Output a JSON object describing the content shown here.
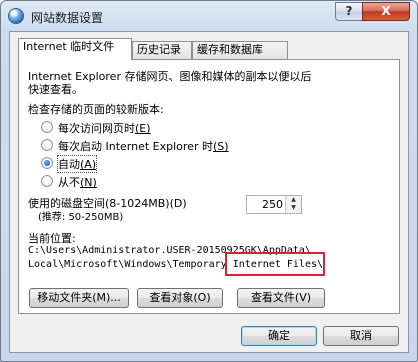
{
  "window": {
    "title": "网站数据设置",
    "help_glyph": "?",
    "close_glyph": "X"
  },
  "tabs": [
    {
      "label": "Internet 临时文件",
      "active": true
    },
    {
      "label": "历史记录",
      "active": false
    },
    {
      "label": "缓存和数据库",
      "active": false
    }
  ],
  "temp_files": {
    "description_line1": "Internet Explorer 存储网页、图像和媒体的副本以便以后",
    "description_line2": "快速查看。",
    "check_label": "检查存储的页面的较新版本:",
    "options": [
      {
        "label": "每次访问网页时",
        "key": "(E)",
        "checked": false
      },
      {
        "label": "每次启动 Internet Explorer 时",
        "key": "(S)",
        "checked": false
      },
      {
        "label": "自动",
        "key": "(A)",
        "checked": true
      },
      {
        "label": "从不",
        "key": "(N)",
        "checked": false
      }
    ],
    "disk_space_label": "使用的磁盘空间(8-1024MB)(D)",
    "disk_space_recommend": "(推荐: 50-250MB)",
    "disk_space_value": "250",
    "location_label": "当前位置:",
    "location_path_line1": "C:\\Users\\Administrator.USER-20150925GK\\AppData\\",
    "location_path_line2": "Local\\Microsoft\\Windows\\Temporary Internet Files\\",
    "move_folder_button": "移动文件夹(M)...",
    "view_objects_button": "查看对象(O)",
    "view_files_button": "查看文件(V)"
  },
  "footer": {
    "ok_button": "确定",
    "cancel_button": "取消"
  },
  "colors": {
    "highlight_border": "#d9232f",
    "selection_radio": "#1a4f9a"
  }
}
